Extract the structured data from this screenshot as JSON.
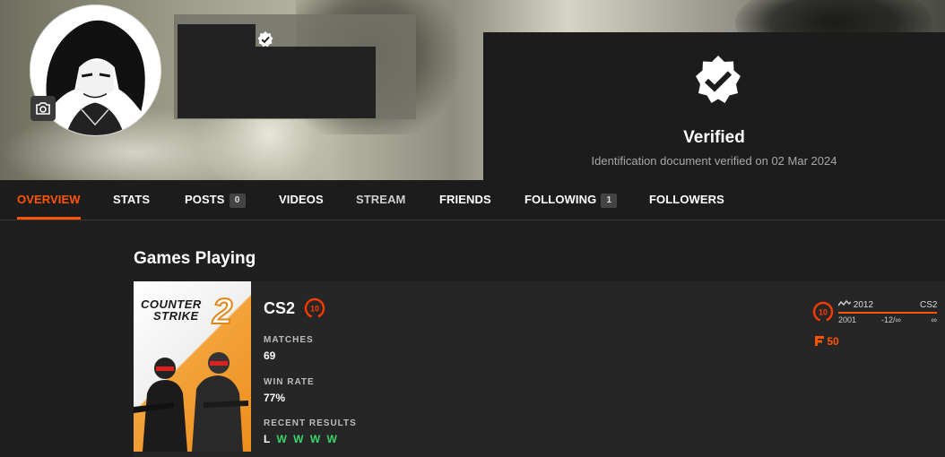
{
  "verification": {
    "title": "Verified",
    "subtitle": "Identification document verified on 02 Mar 2024"
  },
  "nav": {
    "tabs": [
      {
        "label": "OVERVIEW",
        "active": true
      },
      {
        "label": "STATS"
      },
      {
        "label": "POSTS",
        "badge": "0"
      },
      {
        "label": "VIDEOS"
      },
      {
        "label": "STREAM"
      },
      {
        "label": "FRIENDS"
      },
      {
        "label": "FOLLOWING",
        "badge": "1"
      },
      {
        "label": "FOLLOWERS"
      }
    ]
  },
  "games": {
    "section_title": "Games Playing",
    "card": {
      "cover_line1": "COUNTER",
      "cover_line2": "STRIKE",
      "cover_number": "2",
      "name": "CS2",
      "level": "10",
      "matches_label": "MATCHES",
      "matches_value": "69",
      "winrate_label": "WIN RATE",
      "winrate_value": "77%",
      "recent_label": "RECENT RESULTS",
      "recent_results": [
        "L",
        "W",
        "W",
        "W",
        "W"
      ],
      "elo": {
        "level": "10",
        "current": "2012",
        "game": "CS2",
        "min": "2001",
        "delta": "-12/∞",
        "max": "∞"
      },
      "faceit_points": "50"
    }
  },
  "colors": {
    "accent": "#ff5500",
    "win": "#3cd46b",
    "background": "#1f1f1f"
  }
}
